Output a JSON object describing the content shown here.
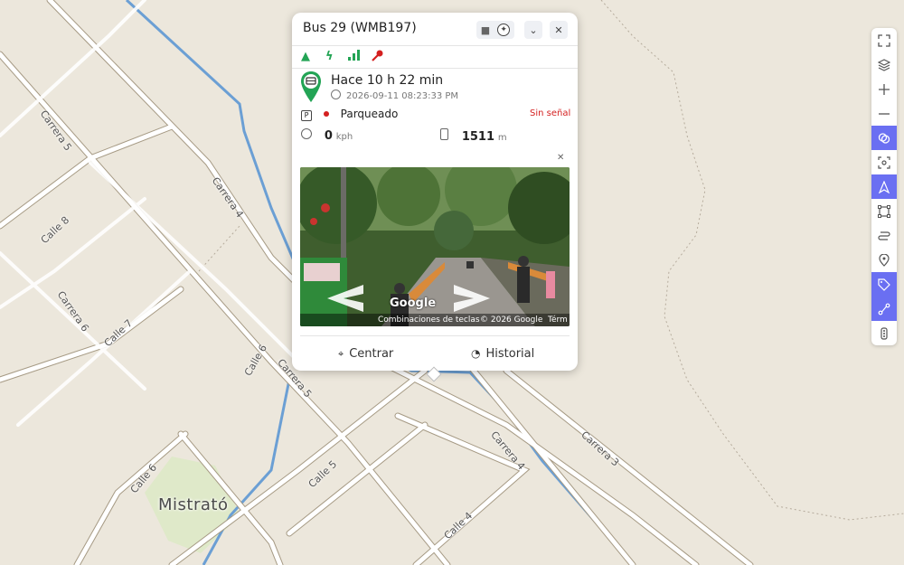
{
  "map": {
    "streets": [
      "Carrera 5",
      "Carrera 4",
      "Calle 8",
      "Carrera 6",
      "Calle 7",
      "Calle 6",
      "Carrera 5",
      "Carrera 4",
      "Carrera 3",
      "Calle 5",
      "Calle 6",
      "Calle 4"
    ],
    "town": "Mistrató"
  },
  "popup": {
    "title": "Bus 29 (WMB197)",
    "ago": "Hace 10 h 22 min",
    "timestamp": "2026-09-11 08:23:33 PM",
    "status": "Parqueado",
    "signal": "Sin señal",
    "speed_value": "0",
    "speed_unit": "kph",
    "odometer_value": "1511",
    "odometer_unit": "m",
    "streetview": {
      "logo": "Google",
      "shortcuts": "Combinaciones de teclas",
      "copyright": "© 2026 Google",
      "terms": "Térm"
    },
    "center_label": "Centrar",
    "history_label": "Historial"
  },
  "colors": {
    "accent": "#6a6ff2",
    "green": "#23a455",
    "red": "#d42020",
    "road": "#a69a84",
    "river": "#6b9fd4"
  },
  "toolbar": [
    "fullscreen-icon",
    "layers-icon",
    "zoom-in-icon",
    "zoom-out-icon",
    "geofence-icon",
    "focus-icon",
    "navigation-icon",
    "polygon-icon",
    "route-icon",
    "location-pin-icon",
    "tag-icon",
    "share-route-icon",
    "traffic-icon"
  ]
}
